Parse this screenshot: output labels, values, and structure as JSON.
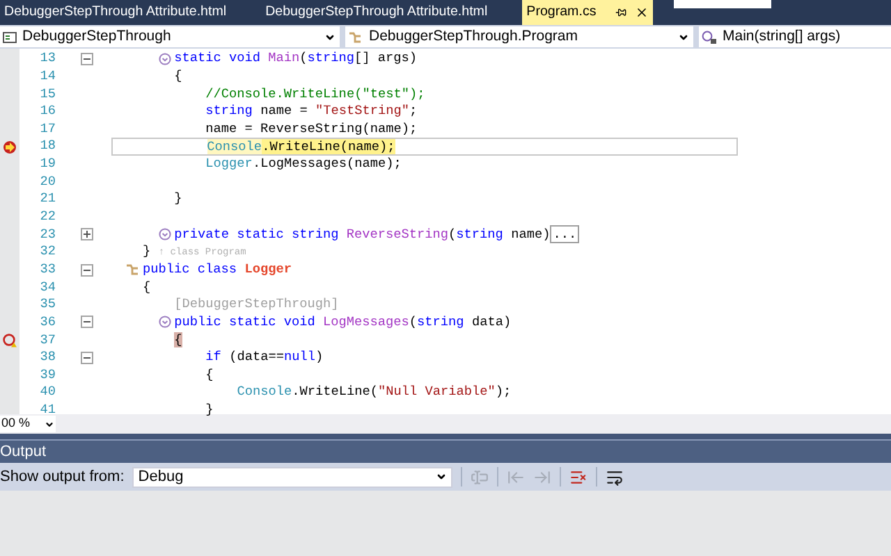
{
  "tabs": [
    {
      "label": "DebuggerStepThrough Attribute.html",
      "selected": false
    },
    {
      "label": "DebuggerStepThrough Attribute.html",
      "selected": false
    },
    {
      "label": "Program.cs",
      "selected": true
    }
  ],
  "navigation": [
    {
      "kind": "project",
      "value": "DebuggerStepThrough"
    },
    {
      "kind": "class",
      "value": "DebuggerStepThrough.Program"
    },
    {
      "kind": "member",
      "value": "Main(string[] args)"
    }
  ],
  "editor": {
    "lines": [
      {
        "number": "13",
        "kind": "method",
        "expanded": true,
        "tokens": [
          {
            "kind": "kw",
            "text": "        static void "
          },
          {
            "kind": "method",
            "text": "Main"
          },
          {
            "kind": "plain",
            "text": "("
          },
          {
            "kind": "kw",
            "text": "string"
          },
          {
            "kind": "plain",
            "text": "[] args)"
          }
        ]
      },
      {
        "number": "14",
        "kind": "statement",
        "tokens": [
          {
            "kind": "plain",
            "text": "        {"
          }
        ]
      },
      {
        "number": "15",
        "kind": "statement",
        "tokens": [
          {
            "kind": "comment",
            "text": "            //Console.WriteLine(\"test\");"
          }
        ]
      },
      {
        "number": "16",
        "kind": "statement",
        "tokens": [
          {
            "kind": "kw",
            "text": "            string"
          },
          {
            "kind": "plain",
            "text": " name = "
          },
          {
            "kind": "str",
            "text": "\"TestString\""
          },
          {
            "kind": "plain",
            "text": ";"
          }
        ]
      },
      {
        "number": "17",
        "kind": "statement",
        "tokens": [
          {
            "kind": "plain",
            "text": "            name = ReverseString(name);"
          }
        ]
      },
      {
        "number": "18",
        "kind": "statement",
        "current": true,
        "tokens": [
          {
            "kind": "hltype",
            "text": "            Console"
          },
          {
            "kind": "hl",
            "text": ".WriteLine(name);"
          }
        ]
      },
      {
        "number": "19",
        "kind": "statement",
        "tokens": [
          {
            "kind": "type",
            "text": "            Logger"
          },
          {
            "kind": "plain",
            "text": ".LogMessages(name);"
          }
        ]
      },
      {
        "number": "20",
        "kind": "statement"
      },
      {
        "number": "21",
        "kind": "statement",
        "tokens": [
          {
            "kind": "plain",
            "text": "        }"
          }
        ]
      },
      {
        "number": "22",
        "kind": "statement"
      },
      {
        "number": "23",
        "kind": "method",
        "expanded": false,
        "tokens": [
          {
            "kind": "kw",
            "text": "        private static string "
          },
          {
            "kind": "method",
            "text": "ReverseString"
          },
          {
            "kind": "plain",
            "text": "("
          },
          {
            "kind": "kw",
            "text": "string"
          },
          {
            "kind": "plain",
            "text": " name)"
          },
          {
            "kind": "collapsed",
            "text": "..."
          }
        ]
      },
      {
        "number": "32",
        "kind": "statement",
        "tokens": [
          {
            "kind": "plain",
            "text": "    } "
          },
          {
            "kind": "hint",
            "text": "↑ class Program"
          }
        ]
      },
      {
        "number": "33",
        "kind": "class",
        "expanded": true,
        "tokens": [
          {
            "kind": "kw",
            "text": "    public class "
          },
          {
            "kind": "classname",
            "text": "Logger"
          }
        ]
      },
      {
        "number": "34",
        "kind": "statement",
        "tokens": [
          {
            "kind": "plain",
            "text": "    {"
          }
        ]
      },
      {
        "number": "35",
        "kind": "statement",
        "tokens": [
          {
            "kind": "attr",
            "text": "        [DebuggerStepThrough]"
          }
        ]
      },
      {
        "number": "36",
        "kind": "method",
        "expanded": true,
        "tokens": [
          {
            "kind": "kw",
            "text": "        public static void "
          },
          {
            "kind": "method",
            "text": "LogMessages"
          },
          {
            "kind": "plain",
            "text": "("
          },
          {
            "kind": "kw",
            "text": "string"
          },
          {
            "kind": "plain",
            "text": " data)"
          }
        ]
      },
      {
        "number": "37",
        "kind": "statement",
        "breakpoint": true,
        "tokens": [
          {
            "kind": "match",
            "text": "        {"
          }
        ]
      },
      {
        "number": "38",
        "kind": "statement",
        "expanded": true,
        "tokens": [
          {
            "kind": "kw",
            "text": "            if"
          },
          {
            "kind": "plain",
            "text": " (data=="
          },
          {
            "kind": "kw",
            "text": "null"
          },
          {
            "kind": "plain",
            "text": ")"
          }
        ]
      },
      {
        "number": "39",
        "kind": "statement",
        "tokens": [
          {
            "kind": "plain",
            "text": "            {"
          }
        ]
      },
      {
        "number": "40",
        "kind": "statement",
        "tokens": [
          {
            "kind": "type",
            "text": "                Console"
          },
          {
            "kind": "plain",
            "text": ".WriteLine("
          },
          {
            "kind": "str",
            "text": "\"Null Variable\""
          },
          {
            "kind": "plain",
            "text": ");"
          }
        ]
      },
      {
        "number": "41",
        "kind": "statement",
        "tokens": [
          {
            "kind": "plain",
            "text": "            }"
          }
        ]
      }
    ],
    "zoom": "00 %"
  },
  "output": {
    "title": "Output",
    "source_label": "Show output from:",
    "source": "Debug",
    "tools": [
      {
        "kind": "goto",
        "disabled": true
      },
      {
        "kind": "prev",
        "disabled": true
      },
      {
        "kind": "next",
        "disabled": true
      },
      {
        "kind": "clear",
        "disabled": false
      },
      {
        "kind": "wrap",
        "disabled": false
      }
    ]
  }
}
